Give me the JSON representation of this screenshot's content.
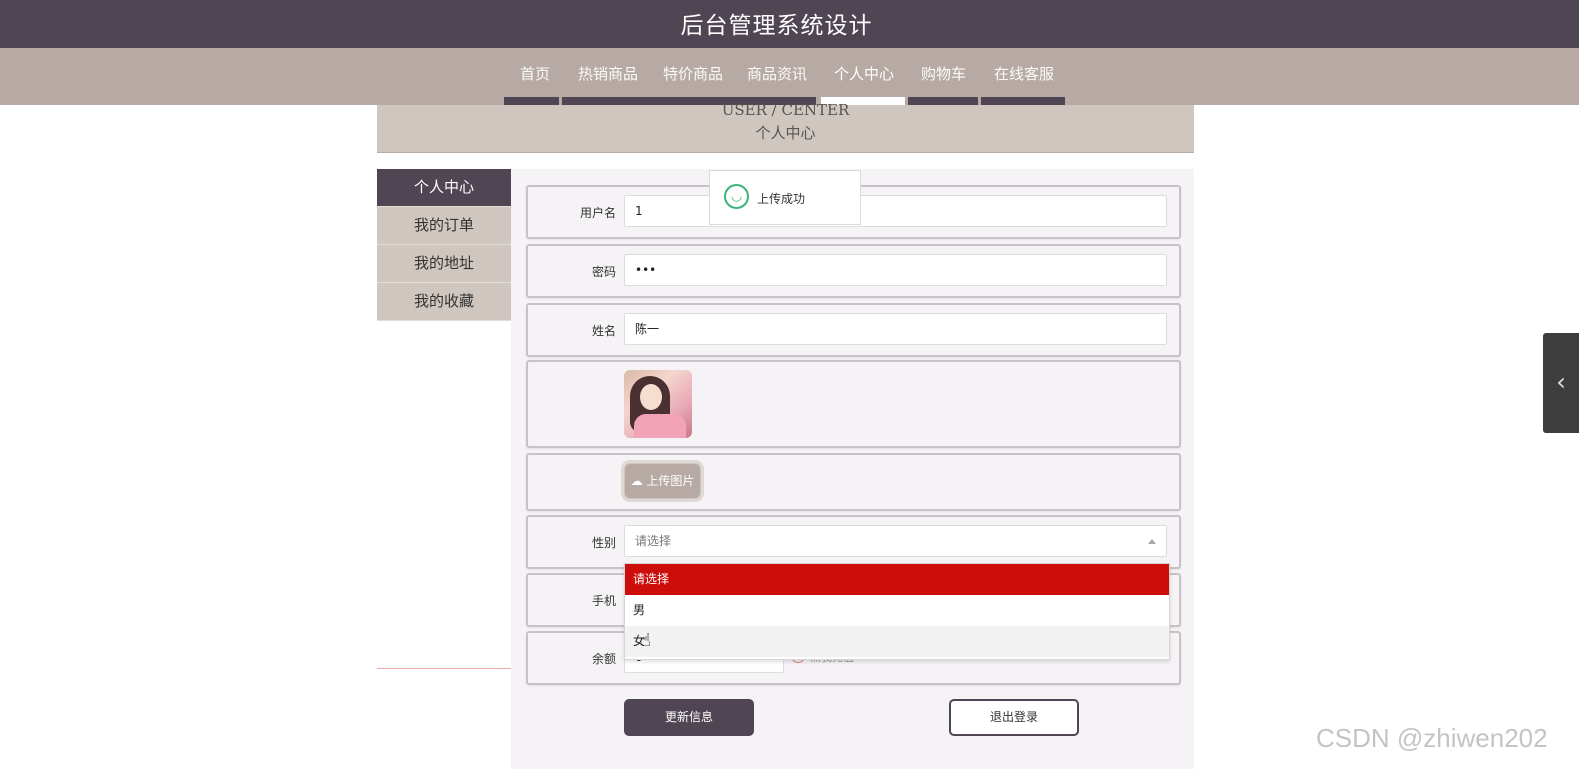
{
  "header": {
    "title": "后台管理系统设计"
  },
  "nav": {
    "items": [
      {
        "label": "首页"
      },
      {
        "label": "热销商品"
      },
      {
        "label": "特价商品"
      },
      {
        "label": "商品资讯"
      },
      {
        "label": "个人中心"
      },
      {
        "label": "购物车"
      },
      {
        "label": "在线客服"
      }
    ],
    "active_index": 4
  },
  "banner": {
    "english": "USER / CENTER",
    "chinese": "个人中心"
  },
  "sidebar": {
    "items": [
      {
        "label": "个人中心"
      },
      {
        "label": "我的订单"
      },
      {
        "label": "我的地址"
      },
      {
        "label": "我的收藏"
      }
    ],
    "active_index": 0
  },
  "form": {
    "username": {
      "label": "用户名",
      "value": "1"
    },
    "password": {
      "label": "密码",
      "value": "•••"
    },
    "name": {
      "label": "姓名",
      "value": "陈一"
    },
    "upload": {
      "label": "上传图片",
      "icon": "cloud-upload-icon"
    },
    "gender": {
      "label": "性别",
      "placeholder": "请选择",
      "options": [
        "请选择",
        "男",
        "女"
      ],
      "highlighted": "请选择",
      "hovered": "女"
    },
    "phone": {
      "label": "手机"
    },
    "balance": {
      "label": "余额",
      "value": "0",
      "recharge_text": "点我充值"
    }
  },
  "buttons": {
    "update": "更新信息",
    "logout": "退出登录"
  },
  "toast": {
    "message": "上传成功",
    "icon": "smile-icon"
  },
  "side_toggle": {
    "icon": "chevron-left-icon"
  },
  "watermark": "CSDN @zhiwen202",
  "colors": {
    "header_bg": "#4f4553",
    "nav_bg": "#b7aaa4",
    "banner_bg": "#cfc6bf",
    "dropdown_selected": "#cc0d0a",
    "toast_icon": "#3cb47a"
  }
}
